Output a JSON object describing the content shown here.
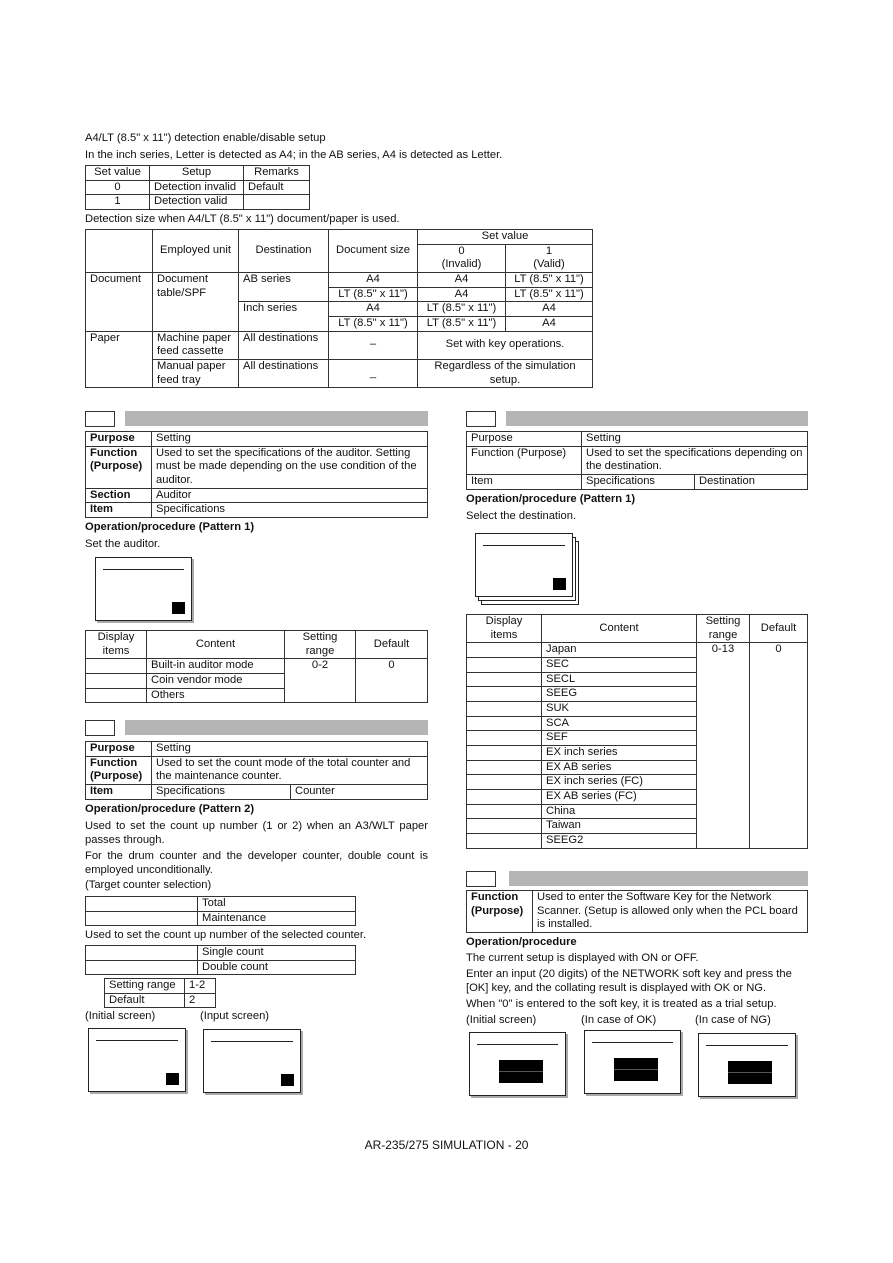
{
  "top": {
    "heading": "A4/LT (8.5\" x 11\") detection enable/disable setup",
    "intro": "In the inch series, Letter is detected as A4; in the AB series, A4 is detected as Letter.",
    "setup_table": {
      "headers": [
        "Set value",
        "Setup",
        "Remarks"
      ],
      "rows": [
        [
          "0",
          "Detection invalid",
          "Default"
        ],
        [
          "1",
          "Detection valid",
          ""
        ]
      ]
    },
    "detection_caption": "Detection size when A4/LT (8.5\" x 11\") document/paper is used.",
    "detection_table": {
      "headers": {
        "employed_unit": "Employed unit",
        "destination": "Destination",
        "document_size": "Document size",
        "set_value": "Set value",
        "v0": "0",
        "v0_label": "(Invalid)",
        "v1": "1",
        "v1_label": "(Valid)"
      },
      "document": {
        "label": "Document",
        "unit": "Document table/SPF",
        "ab_series": "AB series",
        "inch_series": "Inch series",
        "rows": [
          [
            "A4",
            "A4",
            "LT (8.5\"  x 11\")"
          ],
          [
            "LT (8.5\"  x 11\")",
            "A4",
            "LT (8.5\"  x 11\")"
          ],
          [
            "A4",
            "LT (8.5\"  x 11\")",
            "A4"
          ],
          [
            "LT (8.5\"  x 11\")",
            "LT (8.5\"  x 11\")",
            "A4"
          ]
        ]
      },
      "paper": {
        "label": "Paper",
        "rows": [
          {
            "unit": "Machine paper feed cassette",
            "destination": "All destinations",
            "size": "–",
            "value": "Set with key operations."
          },
          {
            "unit": "Manual paper feed tray",
            "destination": "All destinations",
            "size": "_",
            "value": "Regardless of the simulation setup."
          }
        ]
      }
    }
  },
  "auditor": {
    "info": [
      {
        "label": "Purpose",
        "value": "Setting"
      },
      {
        "label": "Function (Purpose)",
        "value": "Used to set the specifications of the auditor. Setting must be made depending on the use condition of the auditor."
      },
      {
        "label": "Section",
        "value": "Auditor"
      },
      {
        "label": "Item",
        "value": "Specifications"
      }
    ],
    "op_heading": "Operation/procedure  (Pattern 1)",
    "op_text": "Set the auditor.",
    "table": {
      "headers": [
        "Display items",
        "Content",
        "Setting range",
        "Default"
      ],
      "contents": [
        "Built-in auditor mode",
        "Coin vendor mode",
        "Others"
      ],
      "range": "0-2",
      "default": "0"
    }
  },
  "counter": {
    "info": [
      {
        "label": "Purpose",
        "value": "Setting"
      },
      {
        "label": "Function (Purpose)",
        "value": "Used to set the count mode of the total counter and the maintenance counter."
      },
      {
        "label": "Item",
        "value": "Specifications",
        "value2": "Counter"
      }
    ],
    "op_heading": "Operation/procedure  (Pattern 2)",
    "para1": "Used to set the count up number (1 or 2) when an A3/WLT paper passes through.",
    "para2": "For the drum counter and the developer counter, double count is employed unconditionally.",
    "target_caption": "(Target counter selection)",
    "targets": [
      "Total",
      "Maintenance"
    ],
    "count_caption": "Used to set the count up number of the selected counter.",
    "counts": [
      "Single count",
      "Double count"
    ],
    "setting_range_label": "Setting range",
    "setting_range": "1-2",
    "default_label": "Default",
    "default": "2",
    "initial_screen": "(Initial screen)",
    "input_screen": "(Input screen)"
  },
  "destination": {
    "info": [
      {
        "label": "Purpose",
        "value": "Setting"
      },
      {
        "label": "Function (Purpose)",
        "value": "Used to set the specifications depending on the destination."
      },
      {
        "label": "Item",
        "value": "Specifications",
        "value2": "Destination"
      }
    ],
    "op_heading": "Operation/procedure  (Pattern 1)",
    "op_text": "Select the destination.",
    "table": {
      "headers": [
        "Display items",
        "Content",
        "Setting range",
        "Default"
      ],
      "contents": [
        "Japan",
        "SEC",
        "SECL",
        "SEEG",
        "SUK",
        "SCA",
        "SEF",
        "EX inch series",
        "EX AB series",
        "EX inch series (FC)",
        "EX AB series (FC)",
        "China",
        "Taiwan",
        "SEEG2"
      ],
      "range": "0-13",
      "default": "0"
    }
  },
  "network": {
    "function_label": "Function (Purpose)",
    "function_value": "Used to enter the Software Key for the Network Scanner. (Setup is allowed only when the PCL board is installed.",
    "op_heading": "Operation/procedure",
    "para1": "The current setup is displayed with ON or OFF.",
    "para2": "Enter an input (20 digits) of the NETWORK soft key and press the [OK] key, and the collating result is displayed with OK or NG.",
    "para3": "When \"0\" is entered to the soft key, it is treated as a trial setup.",
    "screens": [
      "(Initial screen)",
      "(In case of OK)",
      "(In case of NG)"
    ]
  },
  "footer": "AR-235/275 SIMULATION - 20"
}
